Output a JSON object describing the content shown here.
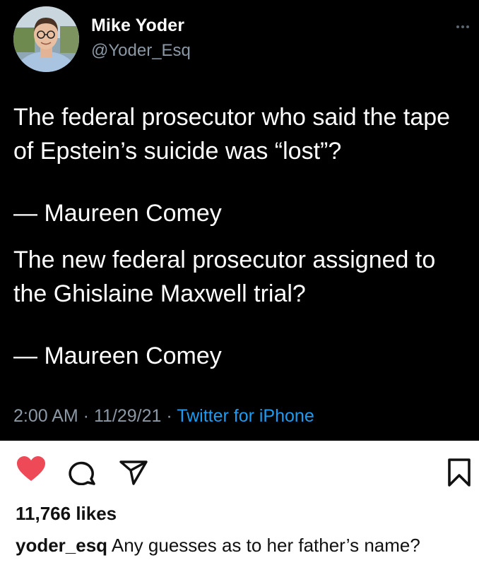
{
  "tweet": {
    "author_name": "Mike Yoder",
    "author_handle": "@Yoder_Esq",
    "paragraphs": [
      "The federal prosecutor who said the tape of Epstein’s suicide was “lost”?",
      "— Maureen Comey",
      "The new federal prosecutor assigned to the Ghislaine Maxwell trial?",
      "— Maureen Comey"
    ],
    "time": "2:00 AM",
    "date": "11/29/21",
    "separator": " · ",
    "source": "Twitter for iPhone"
  },
  "post": {
    "likes": "11,766 likes",
    "caption_user": "yoder_esq",
    "caption_text": "Any guesses as to her father’s name?"
  },
  "icons": {
    "avatar": "profile-photo",
    "more": "more-dots-icon",
    "like": "heart-icon",
    "comment": "comment-bubble-icon",
    "share": "paper-plane-icon",
    "save": "bookmark-icon"
  },
  "colors": {
    "tweet_background": "#000000",
    "tweet_text": "#ffffff",
    "secondary_text": "#8b98a5",
    "link": "#1d9bf0",
    "heart": "#ed4956",
    "post_background": "#ffffff"
  }
}
